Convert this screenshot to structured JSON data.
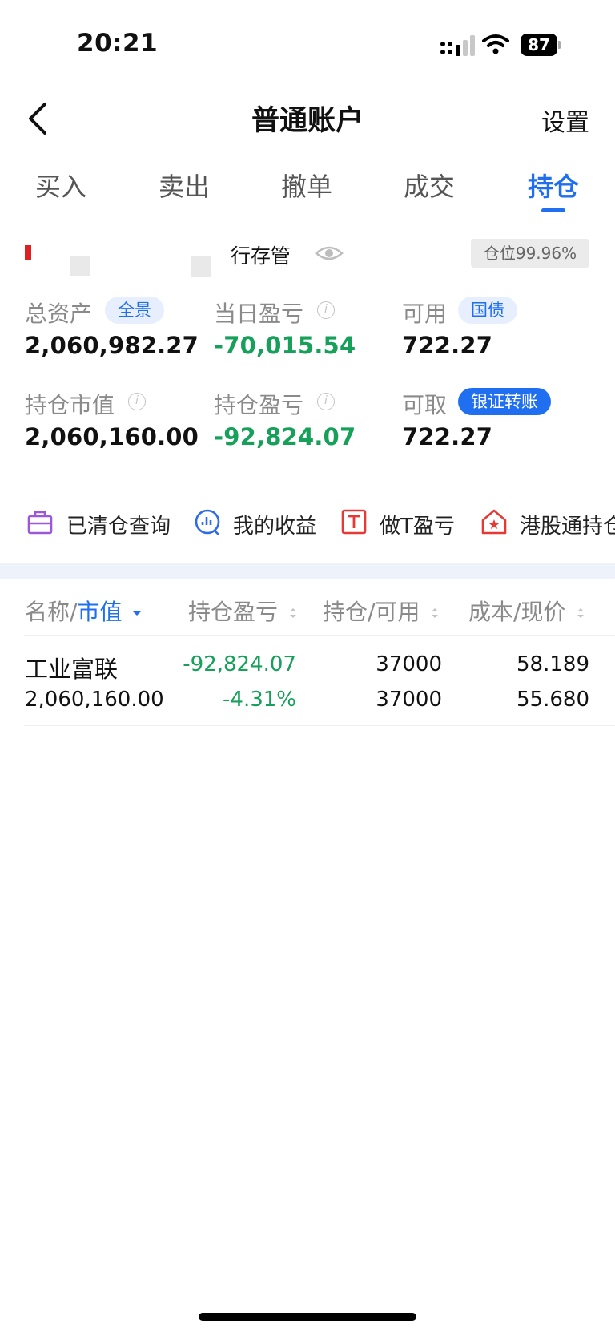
{
  "status_bar": {
    "time": "20:21",
    "battery": "87"
  },
  "nav": {
    "title": "普通账户",
    "settings_label": "设置"
  },
  "tabs": [
    {
      "label": "买入"
    },
    {
      "label": "卖出"
    },
    {
      "label": "撤单"
    },
    {
      "label": "成交"
    },
    {
      "label": "持仓",
      "active": true
    }
  ],
  "account": {
    "bank_label": "行存管",
    "position_ratio": "仓位99.96%"
  },
  "stats": {
    "total_assets": {
      "label": "总资产",
      "badge": "全景",
      "value": "2,060,982.27"
    },
    "daily_pnl": {
      "label": "当日盈亏",
      "value": "-70,015.54"
    },
    "available": {
      "label": "可用",
      "badge": "国债",
      "value": "722.27"
    },
    "market_value": {
      "label": "持仓市值",
      "value": "2,060,160.00"
    },
    "holding_pnl": {
      "label": "持仓盈亏",
      "value": "-92,824.07"
    },
    "withdrawable": {
      "label": "可取",
      "badge": "银证转账",
      "value": "722.27"
    }
  },
  "quick_actions": [
    {
      "label": "已清仓查询",
      "icon": "briefcase-icon"
    },
    {
      "label": "我的收益",
      "icon": "chart-circle-icon"
    },
    {
      "label": "做T盈亏",
      "icon": "t-box-icon"
    },
    {
      "label": "港股通持仓",
      "icon": "hk-home-icon"
    }
  ],
  "table": {
    "headers": {
      "name_prefix": "名称/",
      "name_sort": "市值",
      "pnl": "持仓盈亏",
      "holding": "持仓/可用",
      "cost": "成本/现价"
    },
    "rows": [
      {
        "name": "工业富联",
        "market_value": "2,060,160.00",
        "pnl": "-92,824.07",
        "pnl_pct": "-4.31%",
        "holding": "37000",
        "available": "37000",
        "cost": "58.189",
        "price": "55.680"
      }
    ]
  },
  "colors": {
    "accent": "#1f6ff0",
    "loss": "#16a05a"
  }
}
